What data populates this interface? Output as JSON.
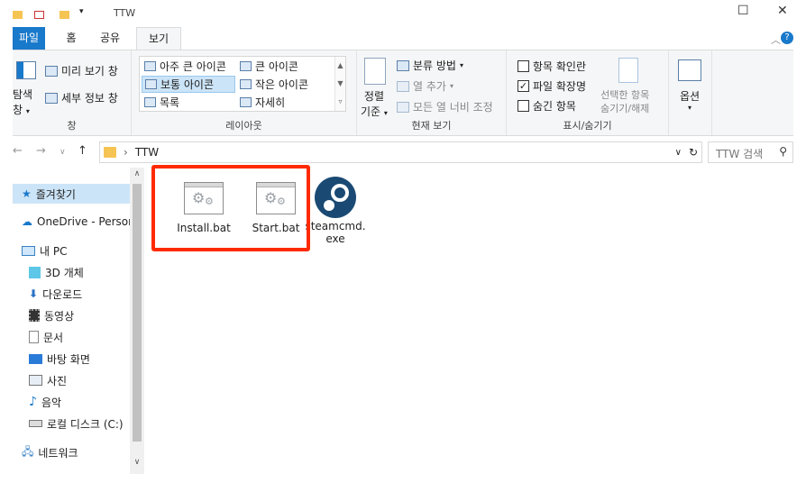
{
  "window": {
    "title": "TTW"
  },
  "tabs": [
    "파일",
    "홈",
    "공유",
    "보기"
  ],
  "ribbon": {
    "pane": {
      "nav_pane_line1": "탐색",
      "nav_pane_line2": "창",
      "preview": "미리 보기 창",
      "details": "세부 정보 창",
      "label": "창"
    },
    "layout": {
      "items": [
        "아주 큰 아이콘",
        "큰 아이콘",
        "보통 아이콘",
        "작은 아이콘",
        "목록",
        "자세히"
      ],
      "selected": "보통 아이콘",
      "label": "레이아웃"
    },
    "current_view": {
      "sort_line1": "정렬",
      "sort_line2": "기준",
      "group_by": "분류 방법",
      "add_column": "열 추가",
      "size_all_columns": "모든 열 너비 조정",
      "label": "현재 보기"
    },
    "show_hide": {
      "item_checkboxes": "항목 확인란",
      "item_checkboxes_checked": false,
      "file_extensions": "파일 확장명",
      "file_extensions_checked": true,
      "hidden_items": "숨긴 항목",
      "hidden_items_checked": false,
      "hide_selected_line1": "선택한 항목",
      "hide_selected_line2": "숨기기/해제",
      "label": "표시/숨기기"
    },
    "options": {
      "label": "옵션"
    }
  },
  "address": {
    "path": "TTW",
    "search_placeholder": "TTW 검색"
  },
  "nav_pane": {
    "items": [
      {
        "label": "즐겨찾기",
        "icon": "star-icon"
      },
      {
        "label": "OneDrive - Persor",
        "icon": "cloud-icon"
      },
      {
        "label": "내 PC",
        "icon": "pc-icon"
      },
      {
        "label": "3D 개체",
        "icon": "cube-icon"
      },
      {
        "label": "다운로드",
        "icon": "download-icon"
      },
      {
        "label": "동영상",
        "icon": "video-icon"
      },
      {
        "label": "문서",
        "icon": "document-icon"
      },
      {
        "label": "바탕 화면",
        "icon": "desktop-icon"
      },
      {
        "label": "사진",
        "icon": "picture-icon"
      },
      {
        "label": "음악",
        "icon": "music-icon"
      },
      {
        "label": "로컬 디스크 (C:)",
        "icon": "disk-icon"
      },
      {
        "label": "네트워크",
        "icon": "network-icon"
      }
    ]
  },
  "files": [
    {
      "name": "Install.bat",
      "icon": "batch-file-icon"
    },
    {
      "name": "Start.bat",
      "icon": "batch-file-icon"
    },
    {
      "name_line1": "steamcmd.",
      "name_line2": "exe",
      "icon": "steam-icon"
    }
  ],
  "colors": {
    "accent": "#1979ca",
    "highlight": "#ff2a00",
    "selection": "#cce4f7"
  }
}
